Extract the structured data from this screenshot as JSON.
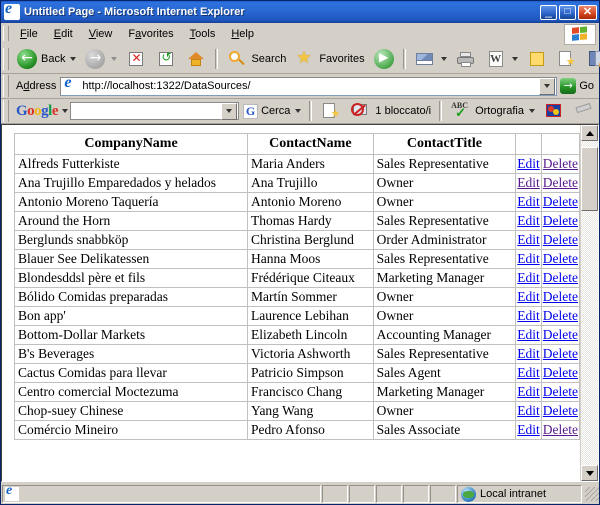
{
  "window": {
    "title": "Untitled Page - Microsoft Internet Explorer",
    "minimize_label": "_",
    "maximize_label": "□",
    "close_label": "✕"
  },
  "menu": {
    "items": [
      {
        "pre": "",
        "acc": "F",
        "post": "ile"
      },
      {
        "pre": "",
        "acc": "E",
        "post": "dit"
      },
      {
        "pre": "",
        "acc": "V",
        "post": "iew"
      },
      {
        "pre": "F",
        "acc": "a",
        "post": "vorites"
      },
      {
        "pre": "",
        "acc": "T",
        "post": "ools"
      },
      {
        "pre": "",
        "acc": "H",
        "post": "elp"
      }
    ]
  },
  "toolbar": {
    "back_label": "Back",
    "search_label": "Search",
    "favorites_label": "Favorites",
    "word_glyph": "W"
  },
  "address": {
    "label_pre": "A",
    "label_acc": "d",
    "label_post": "dress",
    "url": "http://localhost:1322/DataSources/",
    "go_label": "Go",
    "go_glyph": "→"
  },
  "google_bar": {
    "logo": [
      {
        "t": "G",
        "c": "b"
      },
      {
        "t": "o",
        "c": "r"
      },
      {
        "t": "o",
        "c": "y"
      },
      {
        "t": "g",
        "c": "b"
      },
      {
        "t": "l",
        "c": "g"
      },
      {
        "t": "e",
        "c": "r"
      }
    ],
    "search_value": "",
    "search_button_label": "Cerca",
    "search_button_glyph": "G",
    "blocked_label": "1 bloccato/i",
    "spell_label": "Ortografia",
    "abc_label": "ABC"
  },
  "table": {
    "headers": [
      "CompanyName",
      "ContactName",
      "ContactTitle",
      "",
      ""
    ],
    "edit_label": "Edit",
    "delete_label": "Delete",
    "rows": [
      {
        "company": "Alfreds Futterkiste",
        "contact": "Maria Anders",
        "title": "Sales Representative",
        "edit_state": "unvisited",
        "delete_state": "visited"
      },
      {
        "company": "Ana Trujillo Emparedados y helados",
        "contact": "Ana Trujillo",
        "title": "Owner",
        "edit_state": "visited",
        "delete_state": "visited"
      },
      {
        "company": "Antonio Moreno Taquería",
        "contact": "Antonio Moreno",
        "title": "Owner",
        "edit_state": "unvisited",
        "delete_state": "unvisited"
      },
      {
        "company": "Around the Horn",
        "contact": "Thomas Hardy",
        "title": "Sales Representative",
        "edit_state": "unvisited",
        "delete_state": "unvisited"
      },
      {
        "company": "Berglunds snabbköp",
        "contact": "Christina Berglund",
        "title": "Order Administrator",
        "edit_state": "unvisited",
        "delete_state": "unvisited"
      },
      {
        "company": "Blauer See Delikatessen",
        "contact": "Hanna Moos",
        "title": "Sales Representative",
        "edit_state": "unvisited",
        "delete_state": "unvisited"
      },
      {
        "company": "Blondesddsl père et fils",
        "contact": "Frédérique Citeaux",
        "title": "Marketing Manager",
        "edit_state": "unvisited",
        "delete_state": "unvisited"
      },
      {
        "company": "Bólido Comidas preparadas",
        "contact": "Martín Sommer",
        "title": "Owner",
        "edit_state": "unvisited",
        "delete_state": "unvisited"
      },
      {
        "company": "Bon app'",
        "contact": "Laurence Lebihan",
        "title": "Owner",
        "edit_state": "unvisited",
        "delete_state": "unvisited"
      },
      {
        "company": "Bottom-Dollar Markets",
        "contact": "Elizabeth Lincoln",
        "title": "Accounting Manager",
        "edit_state": "unvisited",
        "delete_state": "unvisited"
      },
      {
        "company": "B's Beverages",
        "contact": "Victoria Ashworth",
        "title": "Sales Representative",
        "edit_state": "unvisited",
        "delete_state": "unvisited"
      },
      {
        "company": "Cactus Comidas para llevar",
        "contact": "Patricio Simpson",
        "title": "Sales Agent",
        "edit_state": "unvisited",
        "delete_state": "unvisited"
      },
      {
        "company": "Centro comercial Moctezuma",
        "contact": "Francisco Chang",
        "title": "Marketing Manager",
        "edit_state": "unvisited",
        "delete_state": "unvisited"
      },
      {
        "company": "Chop-suey Chinese",
        "contact": "Yang Wang",
        "title": "Owner",
        "edit_state": "unvisited",
        "delete_state": "unvisited"
      },
      {
        "company": "Comércio Mineiro",
        "contact": "Pedro Afonso",
        "title": "Sales Associate",
        "edit_state": "unvisited",
        "delete_state": "visited"
      }
    ]
  },
  "status": {
    "message": "",
    "zone": "Local intranet"
  },
  "colors": {
    "link_unvisited": "#0000ee",
    "link_visited": "#551a8b",
    "chrome": "#d4d0c8",
    "titlebar": "#1e55bd"
  }
}
